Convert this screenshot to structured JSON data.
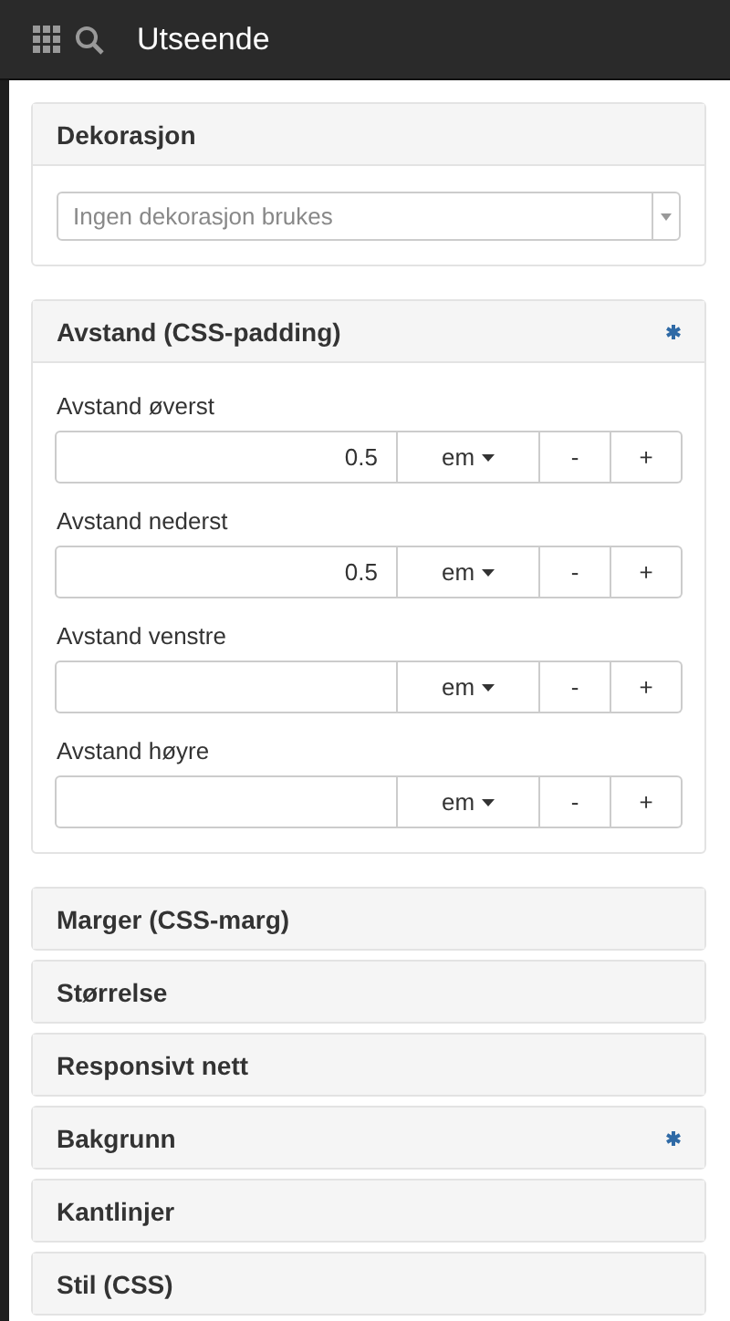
{
  "topbar": {
    "title": "Utseende"
  },
  "sections": [
    {
      "title": "Dekorasjon",
      "modified": false,
      "expanded": true,
      "kind": "select",
      "select": {
        "placeholder": "Ingen dekorasjon brukes"
      }
    },
    {
      "title": "Avstand (CSS-padding)",
      "modified": true,
      "expanded": true,
      "kind": "fields",
      "fields": [
        {
          "label": "Avstand øverst",
          "value": "0.5",
          "unit": "em",
          "minus": "-",
          "plus": "+"
        },
        {
          "label": "Avstand nederst",
          "value": "0.5",
          "unit": "em",
          "minus": "-",
          "plus": "+"
        },
        {
          "label": "Avstand venstre",
          "unit": "em",
          "minus": "-",
          "plus": "+"
        },
        {
          "label": "Avstand høyre",
          "unit": "em",
          "minus": "-",
          "plus": "+"
        }
      ]
    },
    {
      "title": "Marger (CSS-marg)",
      "modified": false,
      "expanded": false
    },
    {
      "title": "Størrelse",
      "modified": false,
      "expanded": false
    },
    {
      "title": "Responsivt nett",
      "modified": false,
      "expanded": false
    },
    {
      "title": "Bakgrunn",
      "modified": true,
      "expanded": false
    },
    {
      "title": "Kantlinjer",
      "modified": false,
      "expanded": false
    },
    {
      "title": "Stil (CSS)",
      "modified": false,
      "expanded": false
    }
  ]
}
